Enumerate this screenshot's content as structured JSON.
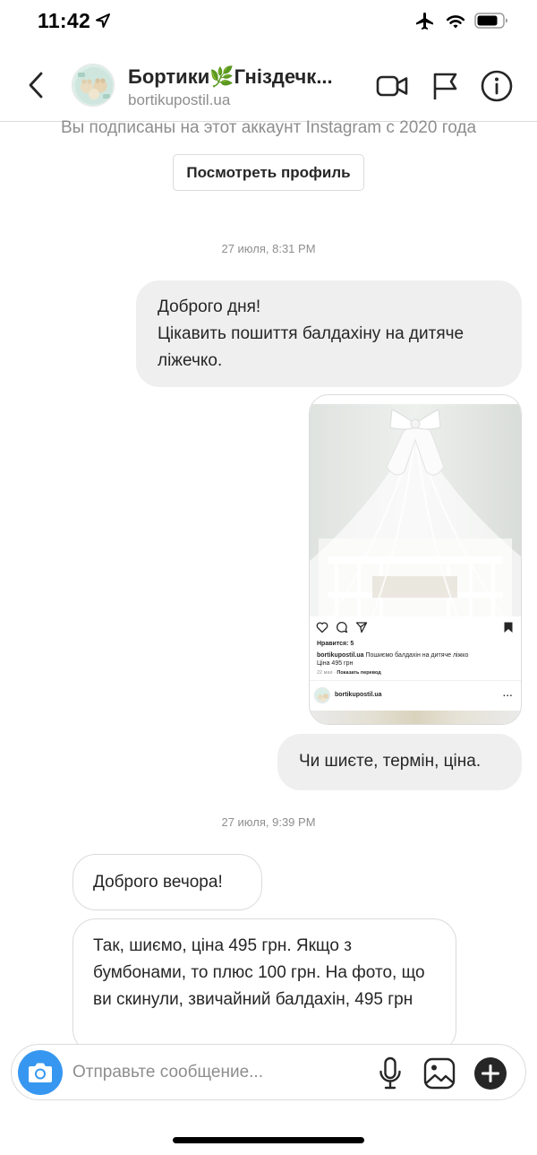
{
  "status_bar": {
    "time": "11:42",
    "icons": [
      "location-arrow-icon",
      "airplane-icon",
      "wifi-icon",
      "battery-icon"
    ]
  },
  "header": {
    "name": "Бортики🌿Гніздечк...",
    "handle": "bortikupostil.ua",
    "icons": [
      "back-icon",
      "video-call-icon",
      "flag-icon",
      "info-icon"
    ]
  },
  "profile_info": {
    "follow_note": "Вы подписаны на этот аккаунт Instagram с 2020 года",
    "view_profile_label": "Посмотреть профиль"
  },
  "messages": {
    "timestamp_1": "27 июля, 8:31 PM",
    "out_1_line_1": "Доброго дня!",
    "out_1_line_2": "Цікавить пошиття балдахіну на дитяче ліжечко.",
    "shared_post": {
      "likes": "Нравится: 5",
      "username": "bortikupostil.ua",
      "caption": "Пошиємо балдахін на дитяче ліжко",
      "price": "Ціна 495 грн",
      "date": "22 мая",
      "translate": "Показать перевод",
      "footer_username": "bortikupostil.ua",
      "more": "..."
    },
    "out_2": "Чи шиєте, термін, ціна.",
    "timestamp_2": "27 июля, 9:39 PM",
    "in_1": "Доброго вечора!",
    "in_2": "Так, шиємо, ціна 495 грн. Якщо з бумбонами, то плюс 100 грн. На фото, що ви скинули, звичайний балдахін, 495 грн"
  },
  "composer": {
    "placeholder": "Отправьте сообщение...",
    "icons": [
      "camera-icon",
      "microphone-icon",
      "gallery-icon",
      "plus-icon"
    ]
  },
  "colors": {
    "accent": "#3797f0",
    "outgoing_bubble": "#efefef",
    "border": "#dbdbdb",
    "secondary_text": "#8e8e8e",
    "primary_text": "#262626"
  }
}
